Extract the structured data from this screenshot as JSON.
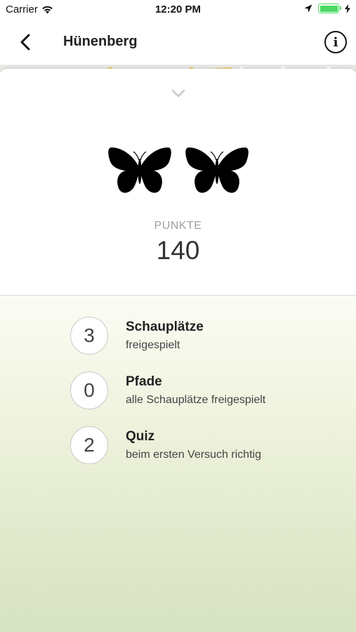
{
  "status_bar": {
    "carrier": "Carrier",
    "time": "12:20 PM",
    "battery_level": 1.0,
    "icons": [
      "wifi-icon",
      "location-arrow-icon",
      "battery-icon",
      "charging-bolt-icon"
    ]
  },
  "nav": {
    "title": "Hünenberg",
    "back_icon": "chevron-left-icon",
    "info_icon": "info-icon",
    "info_glyph": "i"
  },
  "score": {
    "label": "PUNKTE",
    "value": "140",
    "butterflies_count": 2
  },
  "stats": [
    {
      "count": "3",
      "title": "Schauplätze",
      "subtitle": "freigespielt"
    },
    {
      "count": "0",
      "title": "Pfade",
      "subtitle": "alle Schauplätze freigespielt"
    },
    {
      "count": "2",
      "title": "Quiz",
      "subtitle": "beim ersten Versuch richtig"
    }
  ],
  "colors": {
    "accent_green": "#4cd964",
    "gradient_top": "#fbfcf4",
    "gradient_bottom": "#d6e2c0",
    "muted_label": "#a0a0a0"
  }
}
